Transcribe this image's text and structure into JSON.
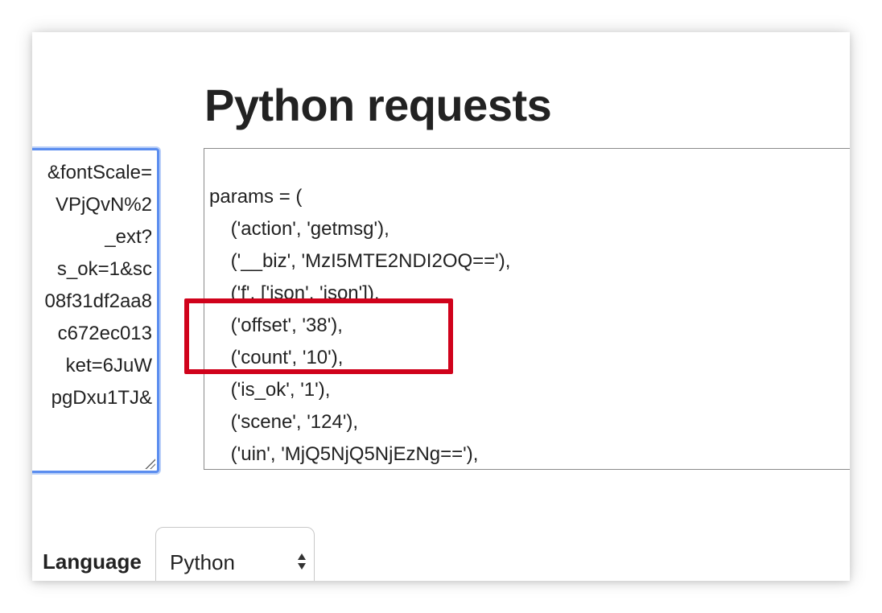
{
  "left_panel": {
    "lines": [
      "&fontScale=",
      "VPjQvN%2",
      "_ext?",
      "s_ok=1&sc",
      "08f31df2aa8",
      "c672ec013",
      "ket=6JuW",
      "pgDxu1TJ&"
    ]
  },
  "heading": "Python requests",
  "code": {
    "lines": [
      "params = (",
      "    ('action', 'getmsg'),",
      "    ('__biz', 'MzI5MTE2NDI2OQ=='),",
      "    ('f', ['json', 'json']),",
      "    ('offset', '38'),",
      "    ('count', '10'),",
      "    ('is_ok', '1'),",
      "    ('scene', '124'),",
      "    ('uin', 'MjQ5NjQ5NjEzNg=='),"
    ]
  },
  "highlight": {
    "color": "#d0021b"
  },
  "language": {
    "label": "Language",
    "selected": "Python"
  },
  "colors": {
    "focus_border": "#5b8def",
    "text": "#222222"
  },
  "icons": {
    "select_arrows": "up-down-arrows-icon",
    "resize_grip": "resize-grip-icon"
  }
}
